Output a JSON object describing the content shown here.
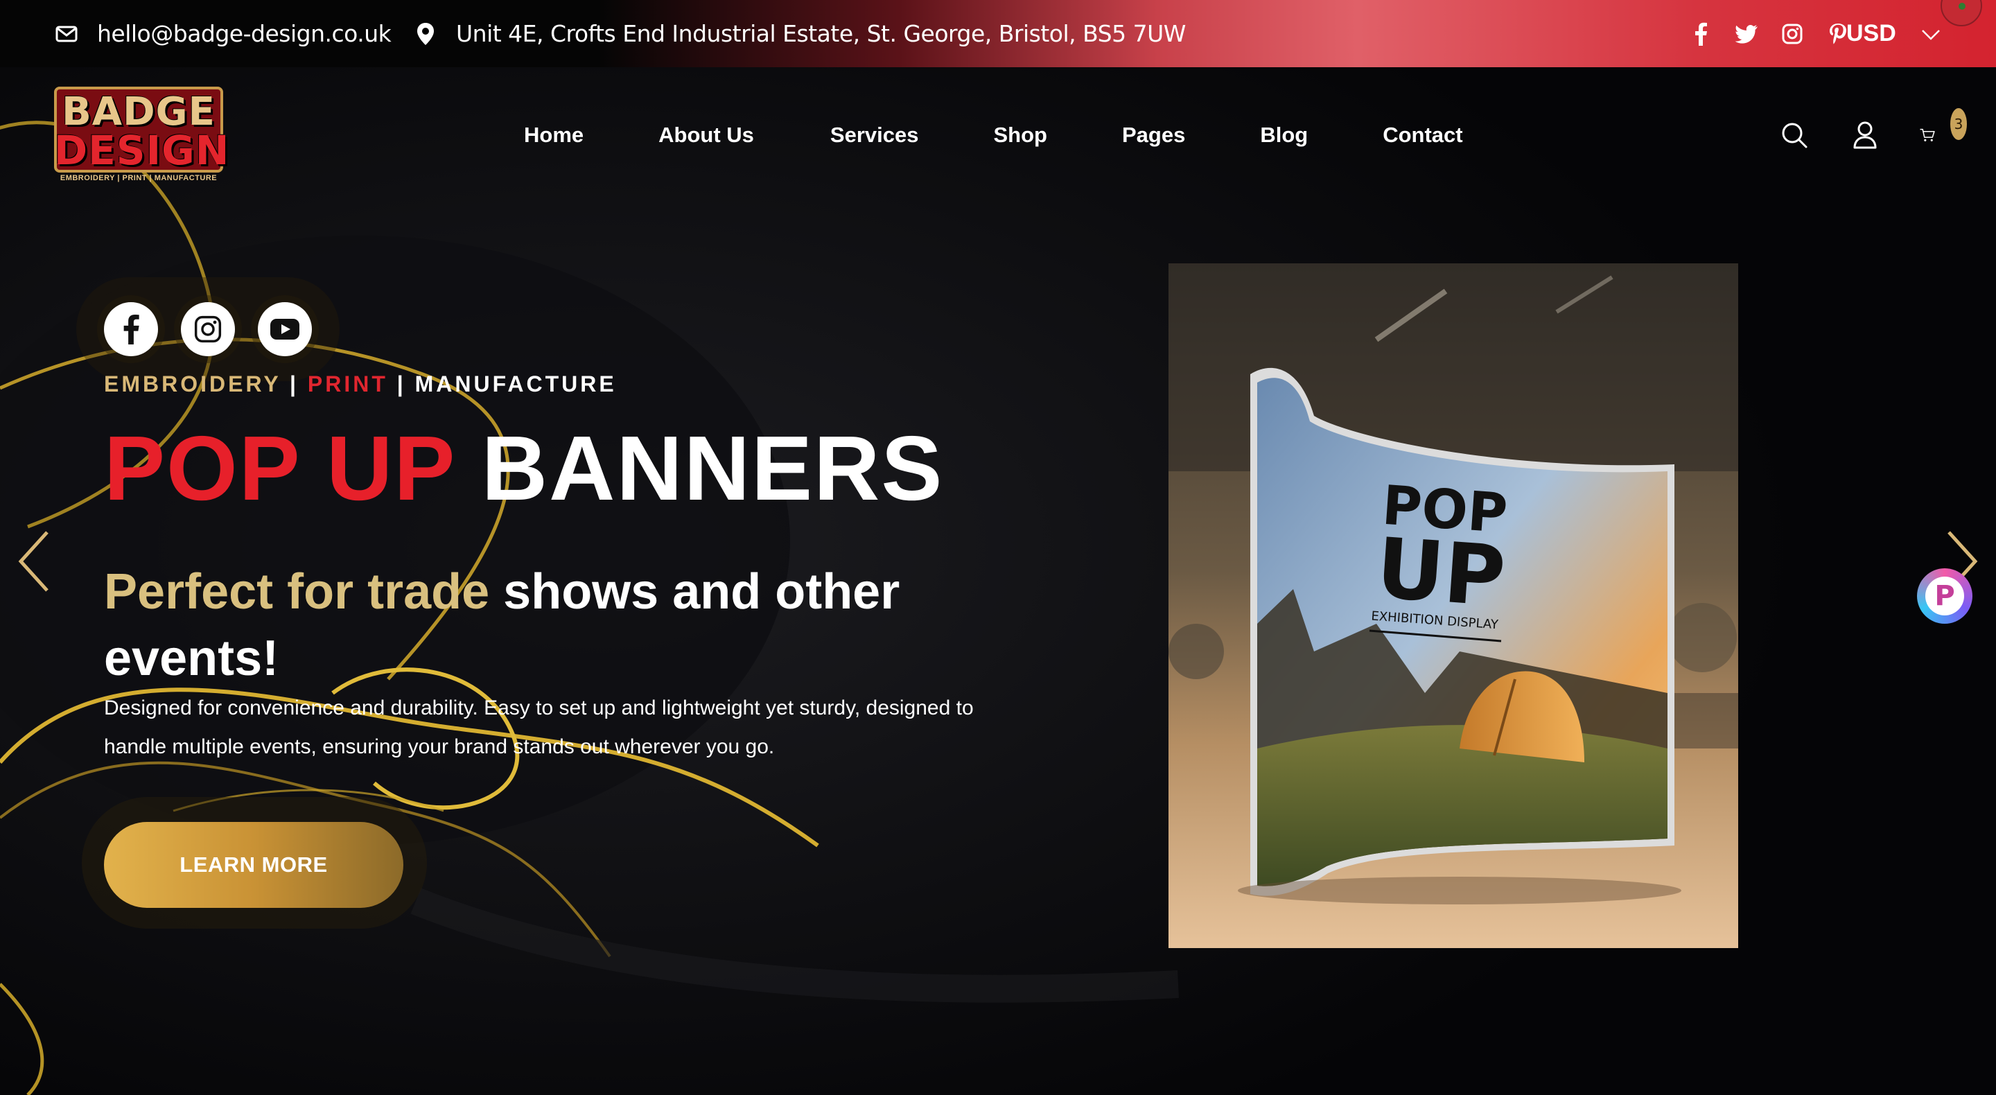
{
  "topbar": {
    "email": "hello@badge-design.co.uk",
    "address": "Unit 4E, Crofts End Industrial Estate, St. George, Bristol, BS5 7UW",
    "socials": [
      "facebook-icon",
      "twitter-icon",
      "instagram-icon",
      "pinterest-icon"
    ],
    "currency": "USD"
  },
  "logo": {
    "line1": "BADGE",
    "line2": "DESIGN",
    "tagline": "EMBROIDERY | PRINT | MANUFACTURE"
  },
  "nav": {
    "items": [
      "Home",
      "About Us",
      "Services",
      "Shop",
      "Pages",
      "Blog",
      "Contact"
    ]
  },
  "header_icons": {
    "cart_count": "3"
  },
  "hero": {
    "socials": [
      "facebook-icon",
      "instagram-icon",
      "youtube-icon"
    ],
    "eyebrow": {
      "part1": "EMBROIDERY",
      "sep1": " | ",
      "part2": "PRINT",
      "sep2": " | ",
      "part3": "MANUFACTURE"
    },
    "headline": {
      "red": "POP UP",
      "white": "BANNERS"
    },
    "subhead": {
      "gold": "Perfect for trade",
      "white": " shows and other events!"
    },
    "description": "Designed for convenience and durability. Easy to set up and lightweight yet sturdy, designed to handle multiple events, ensuring your brand stands out wherever you go.",
    "cta_label": "LEARN MORE"
  },
  "product_image": {
    "banner_line1": "POP",
    "banner_line2": "UP",
    "banner_caption": "EXHIBITION DISPLAY"
  },
  "float_badge": {
    "letter": "P"
  },
  "colors": {
    "accent_red": "#e7202a",
    "accent_gold": "#d9b877",
    "button_gold": "#c99235",
    "background": "#060608"
  }
}
